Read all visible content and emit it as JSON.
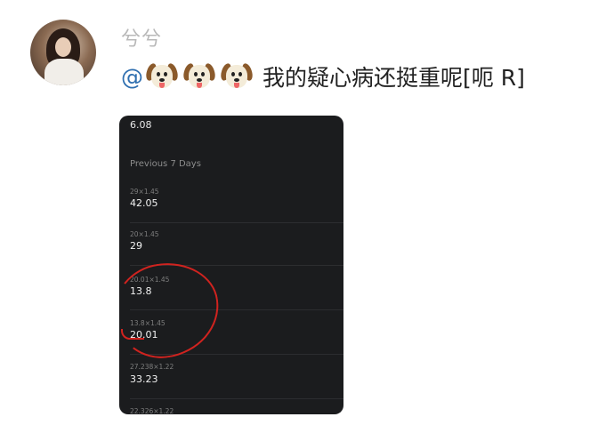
{
  "post": {
    "username": "兮兮",
    "mention": "@",
    "emoji_icons": [
      "dog-face-icon",
      "dog-face-icon",
      "dog-face-icon"
    ],
    "text": "我的疑心病还挺重呢[呃 R]"
  },
  "screenshot": {
    "top_value": "6.08",
    "section_title": "Previous 7 Days",
    "entries": [
      {
        "formula": "29×1.45",
        "result": "42.05"
      },
      {
        "formula": "20×1.45",
        "result": "29"
      },
      {
        "formula": "20.01×1.45",
        "result": "13.8"
      },
      {
        "formula": "13.8×1.45",
        "result": "20.01"
      },
      {
        "formula": "27.238×1.22",
        "result": "33.23"
      },
      {
        "formula": "22.326×1.22",
        "result": ""
      }
    ],
    "annotation_color": "#d0231f"
  }
}
